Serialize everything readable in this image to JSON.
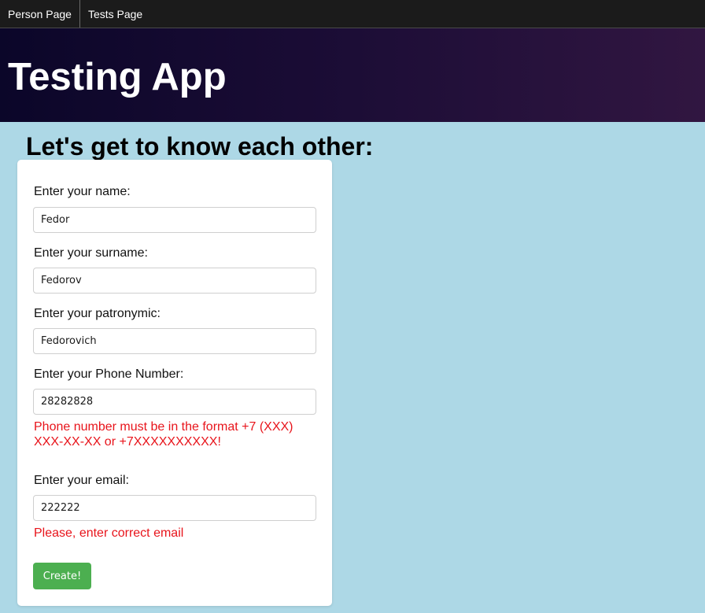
{
  "nav": {
    "items": [
      {
        "label": "Person Page"
      },
      {
        "label": "Tests Page"
      }
    ]
  },
  "header": {
    "title": "Testing App"
  },
  "main": {
    "heading": "Let's get to know each other:"
  },
  "form": {
    "name": {
      "label": "Enter your name:",
      "value": "Fedor"
    },
    "surname": {
      "label": "Enter your surname:",
      "value": "Fedorov"
    },
    "patronymic": {
      "label": "Enter your patronymic:",
      "value": "Fedorovich"
    },
    "phone": {
      "label": "Enter your Phone Number:",
      "value": "28282828",
      "error": "Phone number must be in the format +7 (XXX) XXX-XX-XX or +7XXXXXXXXXX!"
    },
    "email": {
      "label": "Enter your email:",
      "value": "222222",
      "error": "Please, enter correct email"
    },
    "submit_label": "Create!"
  },
  "colors": {
    "page_background": "#add8e6",
    "nav_background": "#1b1b1b",
    "banner_gradient": [
      "#0b0629",
      "#311641"
    ],
    "error_text": "#e8141b",
    "button_background": "#4caf50"
  }
}
